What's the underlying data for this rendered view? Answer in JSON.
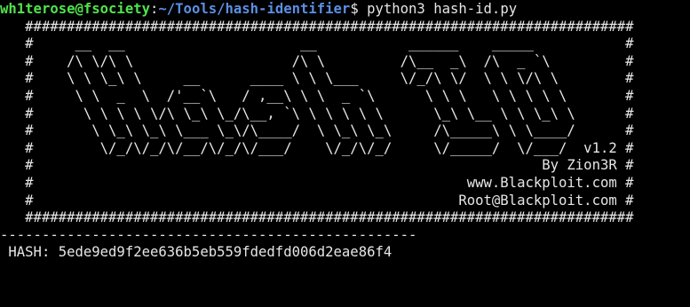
{
  "prompt": {
    "user_host": "wh1terose@fsociety",
    "colon": ":",
    "path": "~/Tools/hash-identifier",
    "dollar": "$",
    "command": " python3 hash-id.py"
  },
  "banner": {
    "lines": [
      "   #########################################################################",
      "   #     __  __                     __           ______    _____           #",
      "   #    /\\ \\/\\ \\                   /\\ \\         /\\__  _\\  /\\  _ `\\         #",
      "   #    \\ \\ \\_\\ \\     __      ____ \\ \\ \\___     \\/_/\\ \\/  \\ \\ \\/\\ \\        #",
      "   #     \\ \\  _  \\  /'__`\\   / ,__\\ \\ \\  _ `\\      \\ \\ \\   \\ \\ \\ \\ \\       #",
      "   #      \\ \\ \\ \\ \\/\\ \\_\\ \\_/\\__, `\\ \\ \\ \\ \\ \\      \\_\\ \\__ \\ \\ \\_\\ \\      #",
      "   #       \\ \\_\\ \\_\\ \\___ \\_\\/\\____/  \\ \\_\\ \\_\\     /\\_____\\ \\ \\____/      #",
      "   #        \\/_/\\/_/\\/__/\\/_/\\/___/    \\/_/\\/_/     \\/_____/  \\/___/  v1.2 #",
      "   #                                                             By Zion3R #",
      "   #                                                    www.Blackploit.com #",
      "   #                                                   Root@Blackploit.com #",
      "   #########################################################################"
    ]
  },
  "divider": "--------------------------------------------------",
  "hash_prompt": " HASH: 5ede9ed9f2ee636b5eb559fdedfd006d2eae86f4",
  "colors": {
    "background": "#000000",
    "text": "#e6e6e6",
    "user_host": "#50e34c",
    "path": "#5b8fe3"
  }
}
